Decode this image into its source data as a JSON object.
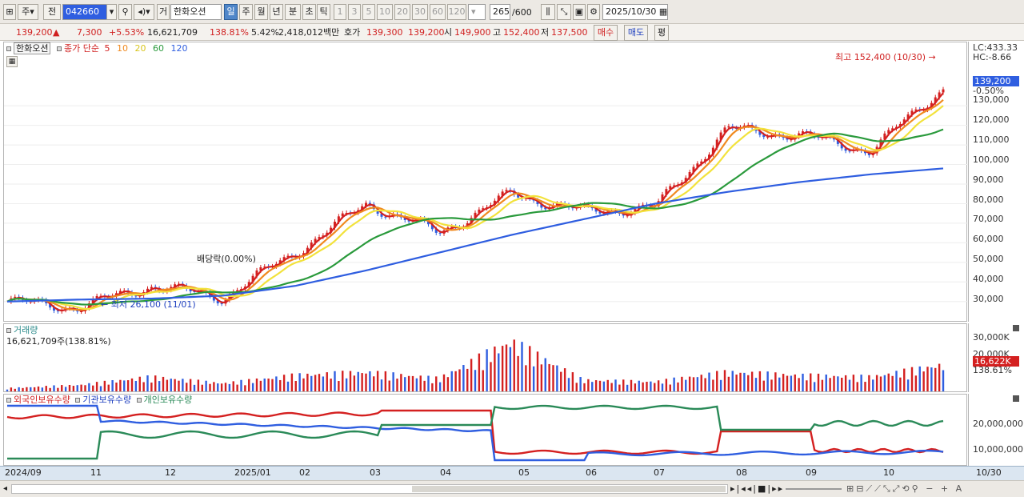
{
  "toolbar": {
    "market_label": "주",
    "prev_label": "전",
    "code_value": "042660",
    "grade_label": "거",
    "stock_name": "한화오션",
    "periods": [
      "일",
      "주",
      "월",
      "년",
      "분",
      "초",
      "틱"
    ],
    "active_period": "일",
    "counts": [
      "1",
      "3",
      "5",
      "10",
      "20",
      "30",
      "60",
      "120"
    ],
    "count_value": "265",
    "count_max": "/600",
    "date_value": "2025/10/30"
  },
  "quote": {
    "price": "139,200",
    "change": "7,300",
    "change_pct": "+5.53%",
    "volume": "16,621,709",
    "volume_ratio": "138.81%",
    "turnover": "5.42%",
    "amount": "2,418,012백만",
    "ask_label": "호가",
    "ask": "139,300",
    "bid": "139,200",
    "open_label": "시",
    "open": "149,900",
    "high_label": "고",
    "high": "152,400",
    "low_label": "저",
    "low": "137,500",
    "buy_label": "매수",
    "sell_label": "매도",
    "eval_label": "평"
  },
  "price_panel": {
    "title": "한화오션",
    "ma_label": "종가 단순",
    "ma_periods": [
      "5",
      "10",
      "20",
      "60",
      "120"
    ],
    "ma_colors": [
      "#d42020",
      "#f08a20",
      "#f2e23c",
      "#2a9a3c",
      "#2f5ee0"
    ],
    "lc": "LC:433.33",
    "hc": "HC:-8.66",
    "current_price": "139,200",
    "current_pct": "-0.50%",
    "high_annotation": "최고 152,400 (10/30)",
    "low_annotation": "최저 26,100 (11/01)",
    "dividend_annotation": "배당락(0.00%)",
    "y_ticks": [
      "130,000",
      "120,000",
      "110,000",
      "100,000",
      "90,000",
      "80,000",
      "70,000",
      "60,000",
      "50,000",
      "40,000",
      "30,000"
    ]
  },
  "volume_panel": {
    "title": "거래량",
    "value": "16,621,709주(138.81%)",
    "y_ticks": [
      "30,000K",
      "20,000K"
    ],
    "current": "16,622K",
    "current_pct": "138.61%"
  },
  "holding_panel": {
    "legend": [
      "외국인보유수량",
      "기관보유수량",
      "개인보유수량"
    ],
    "colors": [
      "#d42020",
      "#2f5ee0",
      "#2a8a58"
    ],
    "y_ticks": [
      "20,000,000",
      "10,000,000"
    ]
  },
  "x_axis": {
    "labels": [
      "2024/09",
      "11",
      "12",
      "2025/01",
      "02",
      "03",
      "04",
      "05",
      "06",
      "07",
      "08",
      "09",
      "10"
    ],
    "end_label": "10/30"
  },
  "chart_data": {
    "type": "line",
    "title": "한화오션",
    "x": [
      "2024/09",
      "11",
      "12",
      "2025/01",
      "02",
      "03",
      "04",
      "05",
      "06",
      "07",
      "08",
      "09",
      "10",
      "10/30"
    ],
    "series": [
      {
        "name": "종가",
        "values": [
          30000,
          27000,
          38000,
          32000,
          55000,
          80000,
          65000,
          85000,
          76000,
          78000,
          118000,
          115000,
          107000,
          139200
        ]
      },
      {
        "name": "120",
        "values": [
          30000,
          31000,
          31500,
          33000,
          38000,
          46000,
          55000,
          64000,
          72000,
          80000,
          86000,
          91000,
          95000,
          98000
        ]
      }
    ],
    "volume_k": [
      2000,
      4000,
      9000,
      5000,
      10000,
      12000,
      8000,
      31000,
      7000,
      6000,
      12000,
      10000,
      9000,
      16622
    ],
    "ylim": [
      25000,
      155000
    ]
  }
}
